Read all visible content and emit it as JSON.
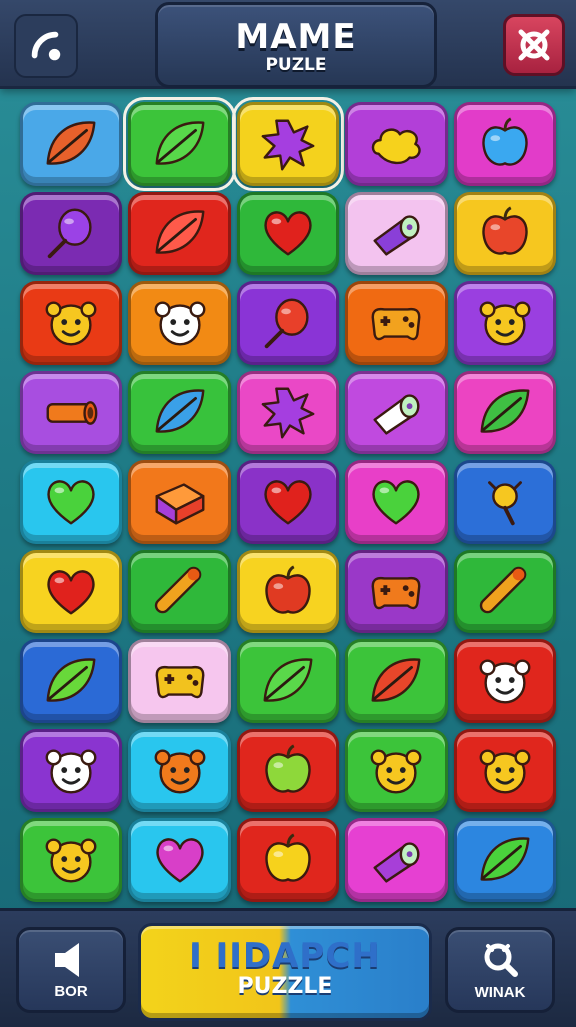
{
  "header": {
    "title": "MAME",
    "subtitle": "PUZLE",
    "back_icon": "phone-back-icon",
    "close_icon": "close-icon"
  },
  "grid": {
    "rows": 9,
    "cols": 5,
    "tiles": [
      {
        "bg": "#4aa8e8",
        "icon": "leaf",
        "fg": "#e7612b"
      },
      {
        "bg": "#3cc43a",
        "icon": "leaf",
        "fg": "#58d84a",
        "selected": true
      },
      {
        "bg": "#f4d21d",
        "icon": "splat",
        "fg": "#a53ee0",
        "selected": true
      },
      {
        "bg": "#b23fd8",
        "icon": "cloud",
        "fg": "#f6d21c"
      },
      {
        "bg": "#e23cc9",
        "icon": "apple",
        "fg": "#3aa8f0"
      },
      {
        "bg": "#7b2bb2",
        "icon": "balloon",
        "fg": "#9b42e6"
      },
      {
        "bg": "#e0261d",
        "icon": "leaf",
        "fg": "#ff5a4a"
      },
      {
        "bg": "#2fb83a",
        "icon": "heart",
        "fg": "#e0221d"
      },
      {
        "bg": "#f3c3ef",
        "icon": "roll",
        "fg": "#8a3fd8"
      },
      {
        "bg": "#f6c71f",
        "icon": "apple",
        "fg": "#e8462a"
      },
      {
        "bg": "#e93a15",
        "icon": "face",
        "fg": "#f6c720"
      },
      {
        "bg": "#f28a14",
        "icon": "face",
        "fg": "#ffffff"
      },
      {
        "bg": "#8a34d6",
        "icon": "balloon",
        "fg": "#e8402a"
      },
      {
        "bg": "#f06a12",
        "icon": "gamepad",
        "fg": "#f2a21e"
      },
      {
        "bg": "#9a3fe0",
        "icon": "face",
        "fg": "#f6c720"
      },
      {
        "bg": "#a84ee0",
        "icon": "cannon",
        "fg": "#f07a1c"
      },
      {
        "bg": "#38c23c",
        "icon": "leaf",
        "fg": "#3aa0e8"
      },
      {
        "bg": "#ea48c6",
        "icon": "splat",
        "fg": "#a53ee0"
      },
      {
        "bg": "#c04adf",
        "icon": "roll",
        "fg": "#ffffff"
      },
      {
        "bg": "#ec44c2",
        "icon": "leaf",
        "fg": "#3fc043"
      },
      {
        "bg": "#29c6ee",
        "icon": "heart",
        "fg": "#4ad23c"
      },
      {
        "bg": "#f2781b",
        "icon": "box",
        "fg": "#a73fd8"
      },
      {
        "bg": "#8a32c8",
        "icon": "heart",
        "fg": "#e0221d"
      },
      {
        "bg": "#e83fc8",
        "icon": "heart",
        "fg": "#4ad23c"
      },
      {
        "bg": "#2c6fd8",
        "icon": "lamp",
        "fg": "#f6c720"
      },
      {
        "bg": "#f7d320",
        "icon": "heart",
        "fg": "#e0221d"
      },
      {
        "bg": "#2fb83a",
        "icon": "bone",
        "fg": "#f0a21e"
      },
      {
        "bg": "#f7d320",
        "icon": "apple",
        "fg": "#e03a22"
      },
      {
        "bg": "#9a38c8",
        "icon": "gamepad",
        "fg": "#f07a1c"
      },
      {
        "bg": "#2fb83a",
        "icon": "bone",
        "fg": "#f0a21e"
      },
      {
        "bg": "#2b6ad6",
        "icon": "leaf",
        "fg": "#68d83a"
      },
      {
        "bg": "#f6c6ee",
        "icon": "gamepad",
        "fg": "#f2c21e"
      },
      {
        "bg": "#3cc43a",
        "icon": "leaf",
        "fg": "#5ad84a"
      },
      {
        "bg": "#3cc43a",
        "icon": "leaf",
        "fg": "#e8462a"
      },
      {
        "bg": "#e0261d",
        "icon": "face",
        "fg": "#ffffff"
      },
      {
        "bg": "#8a34d0",
        "icon": "face",
        "fg": "#ffffff"
      },
      {
        "bg": "#29c6ee",
        "icon": "face",
        "fg": "#f07a1c"
      },
      {
        "bg": "#e0261d",
        "icon": "apple",
        "fg": "#8ed83a"
      },
      {
        "bg": "#3cc43a",
        "icon": "face",
        "fg": "#f6c720"
      },
      {
        "bg": "#e0261d",
        "icon": "face",
        "fg": "#f6c720"
      },
      {
        "bg": "#3cc43a",
        "icon": "face",
        "fg": "#f6c720"
      },
      {
        "bg": "#29c6ee",
        "icon": "heart",
        "fg": "#d83fc8"
      },
      {
        "bg": "#e0261d",
        "icon": "apple",
        "fg": "#f6d21c"
      },
      {
        "bg": "#e640d2",
        "icon": "roll",
        "fg": "#a73fd8"
      },
      {
        "bg": "#2c86e0",
        "icon": "leaf",
        "fg": "#4ad23c"
      }
    ]
  },
  "footer": {
    "left_label": "BOR",
    "left_icon": "speaker-icon",
    "center_line1": "I IIDAPCH",
    "center_line2": "PUZZLE",
    "right_label": "WINAK",
    "right_icon": "search-icon"
  }
}
